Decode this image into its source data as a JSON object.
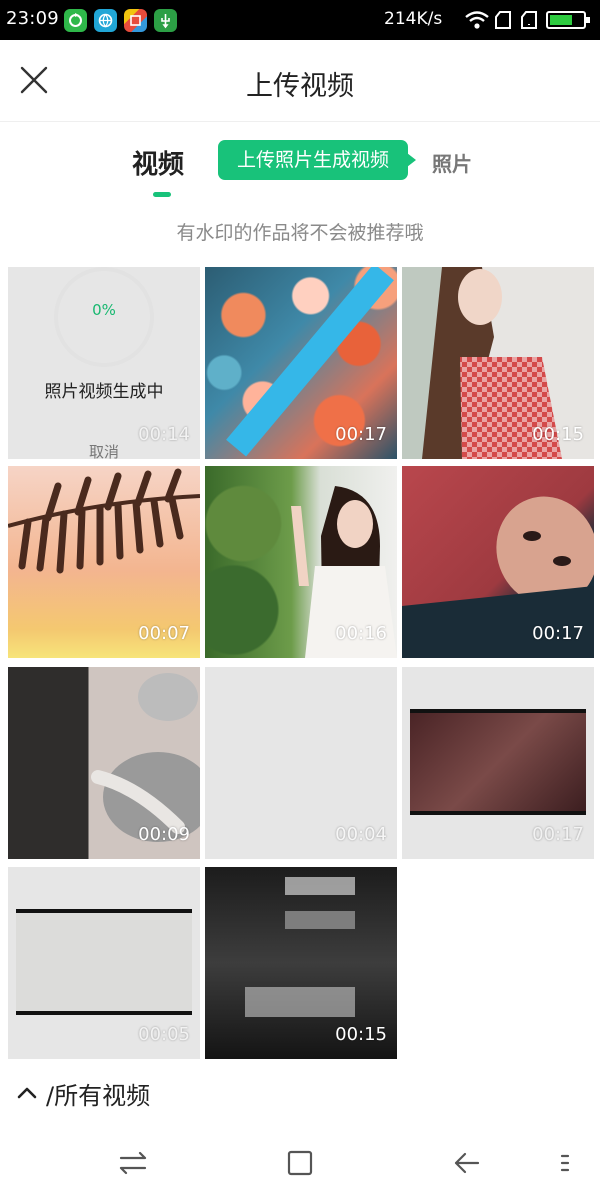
{
  "status_bar": {
    "time": "23:09",
    "network_speed": "214K/s",
    "app_icons": [
      "sync-app-icon",
      "globe-app-icon",
      "colorful-app-icon",
      "usb-icon"
    ],
    "battery_color": "#2ecc40"
  },
  "header": {
    "title": "上传视频",
    "close_icon": "close-icon"
  },
  "tabs": {
    "video_label": "视频",
    "bubble_label": "上传照片生成视频",
    "photo_label": "照片",
    "accent_color": "#18c27a"
  },
  "notice": "有水印的作品将不会被推荐哦",
  "generating": {
    "percent": "0%",
    "label": "照片视频生成中",
    "duration": "00:14",
    "cancel": "取消"
  },
  "videos": [
    {
      "duration": "00:17"
    },
    {
      "duration": "00:15"
    },
    {
      "duration": "00:07"
    },
    {
      "duration": "00:16"
    },
    {
      "duration": "00:17"
    },
    {
      "duration": "00:09"
    },
    {
      "duration": "00:04"
    },
    {
      "duration": "00:17"
    },
    {
      "duration": "00:05"
    },
    {
      "duration": "00:15"
    }
  ],
  "album": {
    "label": "/所有视频",
    "icon": "chevron-up-icon"
  },
  "nav": [
    "switch-icon",
    "home-square-icon",
    "back-icon",
    "menu-icon"
  ]
}
